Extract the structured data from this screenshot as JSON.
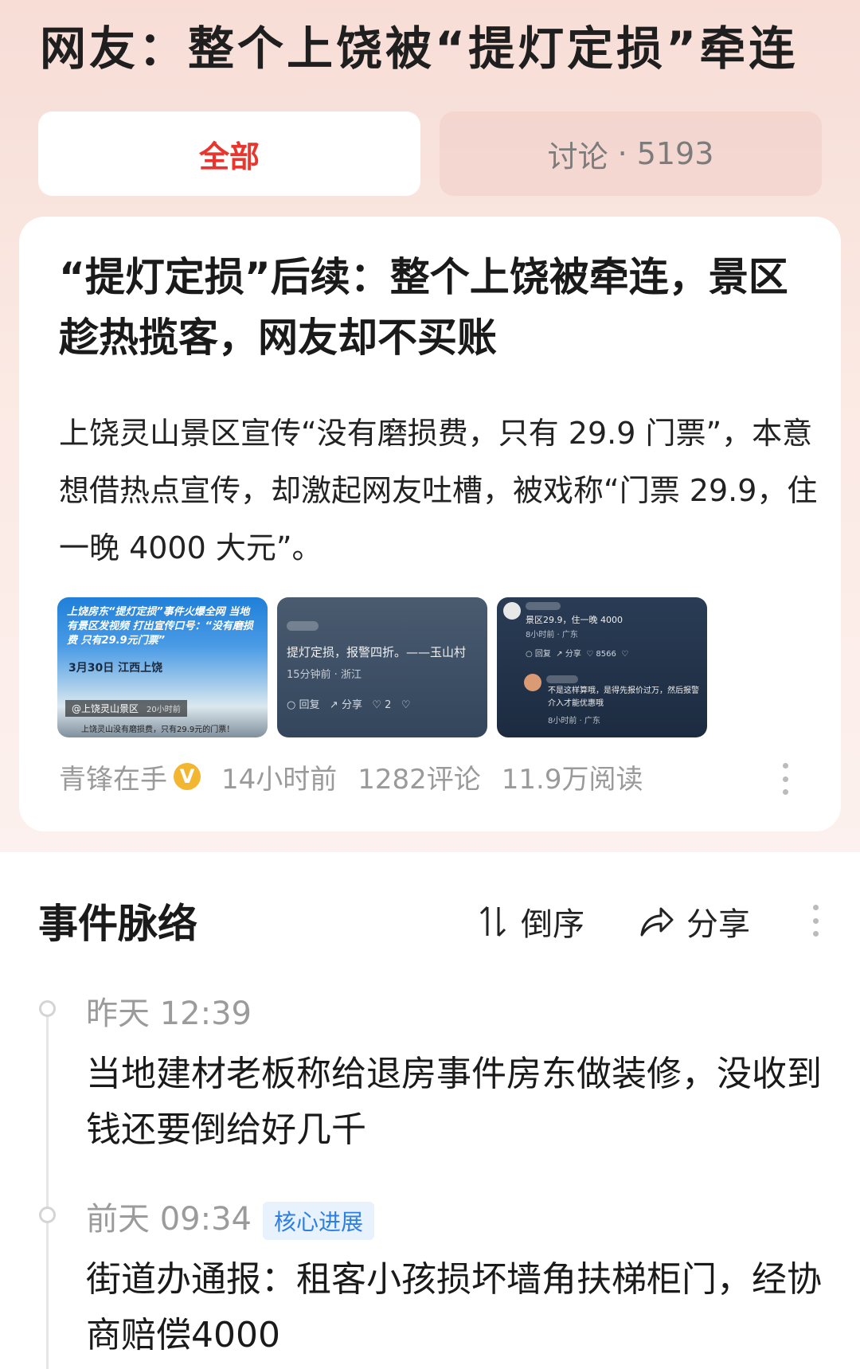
{
  "page_title": "网友：整个上饶被“提灯定损”牵连",
  "tabs": {
    "all_label": "全部",
    "discuss_label": "讨论",
    "discuss_separator": "·",
    "discuss_count": "5193"
  },
  "article": {
    "title": "“提灯定损”后续：整个上饶被牵连，景区趁热揽客，网友却不买账",
    "summary": "上饶灵山景区宣传“没有磨损费，只有 29.9 门票”，本意想借热点宣传，却激起网友吐槽，被戏称“门票 29.9，住一晚 4000 大元”。",
    "thumb1": {
      "headline": "上饶房东“提灯定损”事件火爆全网 当地有景区发视频 打出宣传口号：“没有磨损费 只有29.9元门票”",
      "date": "3月30日 江西上饶",
      "source": "@上饶灵山景区",
      "time": "20小时前",
      "footer": "上饶灵山没有磨损费，只有29.9元的门票！"
    },
    "thumb2": {
      "text": "提灯定损，报警四折。——玉山村",
      "meta": "15分钟前 · 浙江",
      "reply": "回复",
      "share": "分享",
      "likes": "2"
    },
    "thumb3": {
      "text1": "景区29.9，住一晚 4000",
      "meta1": "8小时前 · 广东",
      "reply": "回复",
      "share": "分享",
      "likes": "8566",
      "text2": "不是这样算哦，是得先报价过万，然后报警介入才能优惠哦",
      "meta2": "8小时前 · 广东"
    },
    "author": "青锋在手",
    "verified_mark": "V",
    "time": "14小时前",
    "comments": "1282评论",
    "reads": "11.9万阅读"
  },
  "timeline": {
    "title": "事件脉络",
    "reverse_label": "倒序",
    "share_label": "分享",
    "events": [
      {
        "time": "昨天 12:39",
        "text": "当地建材老板称给退房事件房东做装修，没收到钱还要倒给好几千",
        "badge": ""
      },
      {
        "time": "前天 09:34",
        "text": "街道办通报：租客小孩损坏墙角扶梯柜门，经协商赔偿4000",
        "badge": "核心进展"
      }
    ]
  },
  "colors": {
    "accent_red": "#e8352e",
    "badge_blue": "#2f7fe0",
    "verified_gold": "#f2b630"
  }
}
